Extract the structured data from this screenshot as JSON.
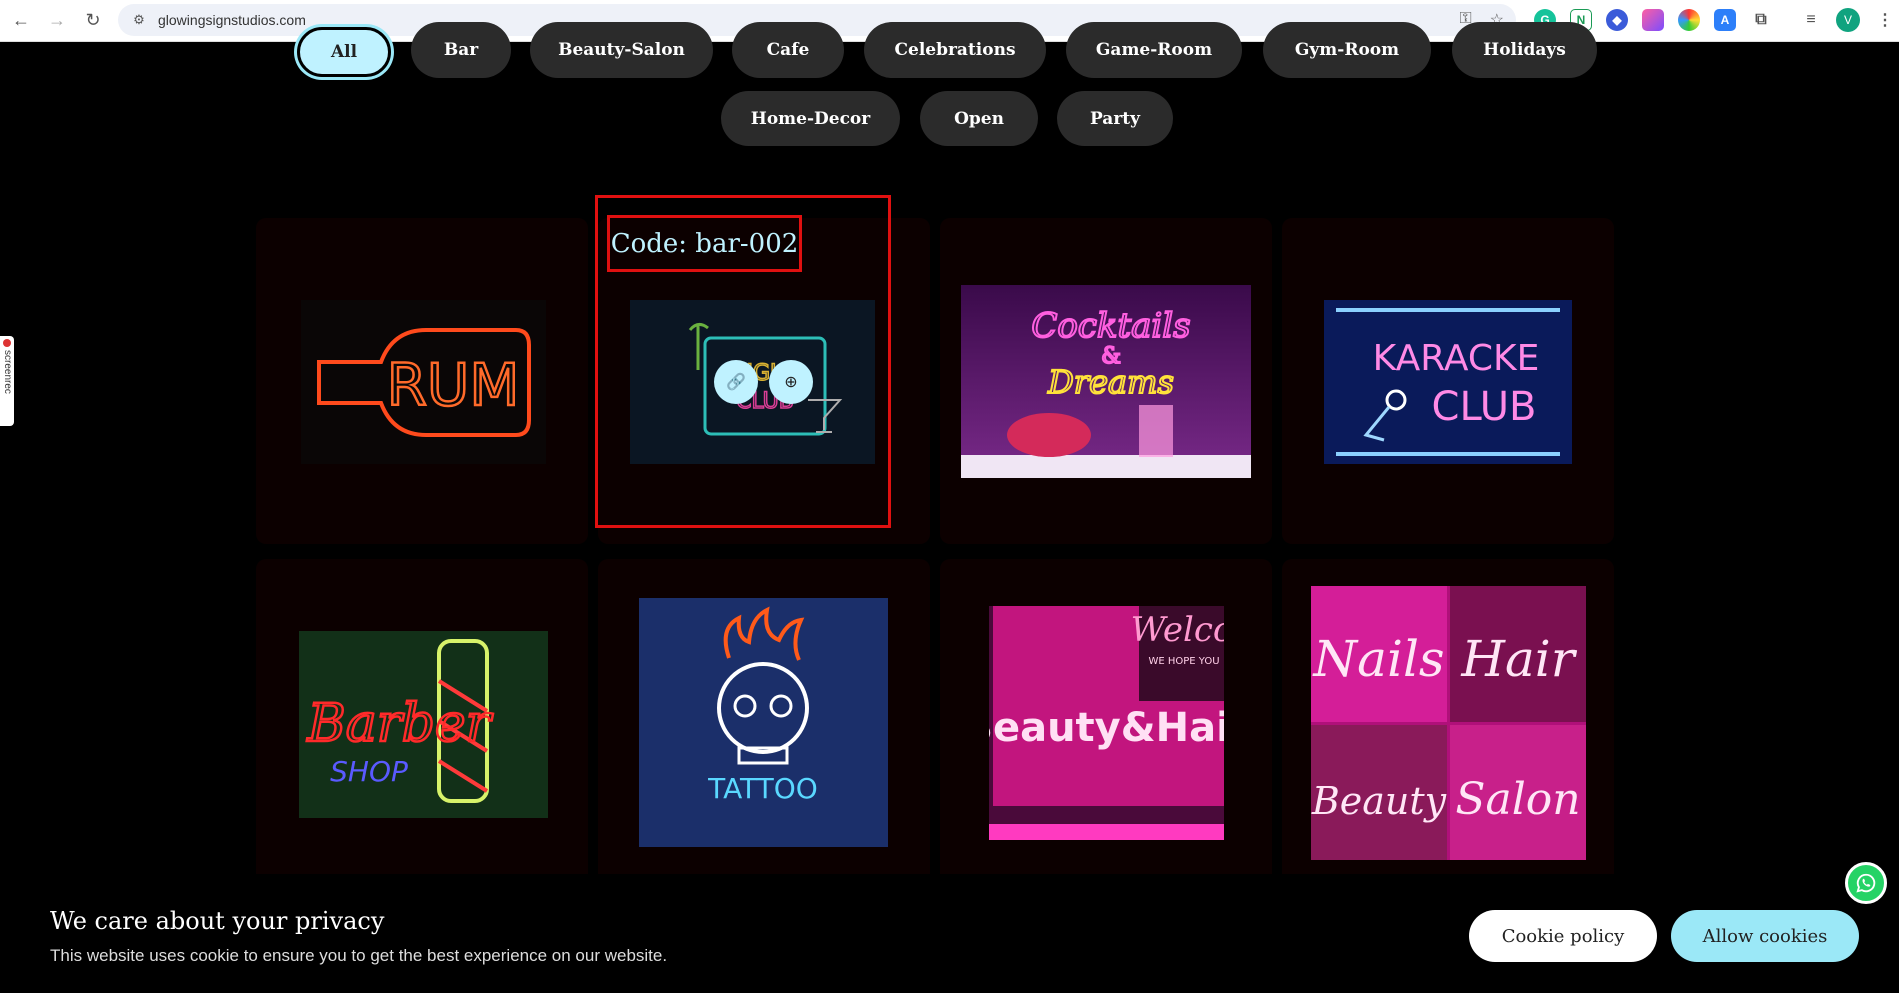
{
  "browser": {
    "url": "glowingsignstudios.com",
    "avatar_letter": "V",
    "ext_n": "N"
  },
  "screenrec": {
    "label": "screenrec"
  },
  "filters": {
    "items": [
      "All",
      "Bar",
      "Beauty-Salon",
      "Cafe",
      "Celebrations",
      "Game-Room",
      "Gym-Room",
      "Holidays",
      "Home-Decor",
      "Open",
      "Party"
    ],
    "active": "All"
  },
  "gallery": {
    "hover_code": "Code: bar-002",
    "signs": {
      "rum": "RUM",
      "night_club_top": "NIGHT",
      "night_club_bottom": "CLUB",
      "cocktails_1": "Cocktails",
      "cocktails_amp": "&",
      "cocktails_2": "Dreams",
      "karaoke_1": "KARACKE",
      "karaoke_2": "CLUB",
      "barber_1": "Barber",
      "barber_2": "SHOP",
      "tattoo": "TATTOO",
      "beauty_hair": "Beauty&Hair",
      "welcome": "Welco",
      "welcome_sub": "WE HOPE YOU",
      "nails": "Nails",
      "hair": "Hair",
      "beauty": "Beauty",
      "salon": "Salon"
    }
  },
  "cookie": {
    "title": "We care about your privacy",
    "description": "This website uses cookie to ensure you to get the best experience on our website.",
    "policy_label": "Cookie policy",
    "allow_label": "Allow cookies"
  },
  "colors": {
    "accent": "#9be8f7",
    "highlight_red": "#e01010",
    "pill_bg": "#2b2b2b"
  }
}
